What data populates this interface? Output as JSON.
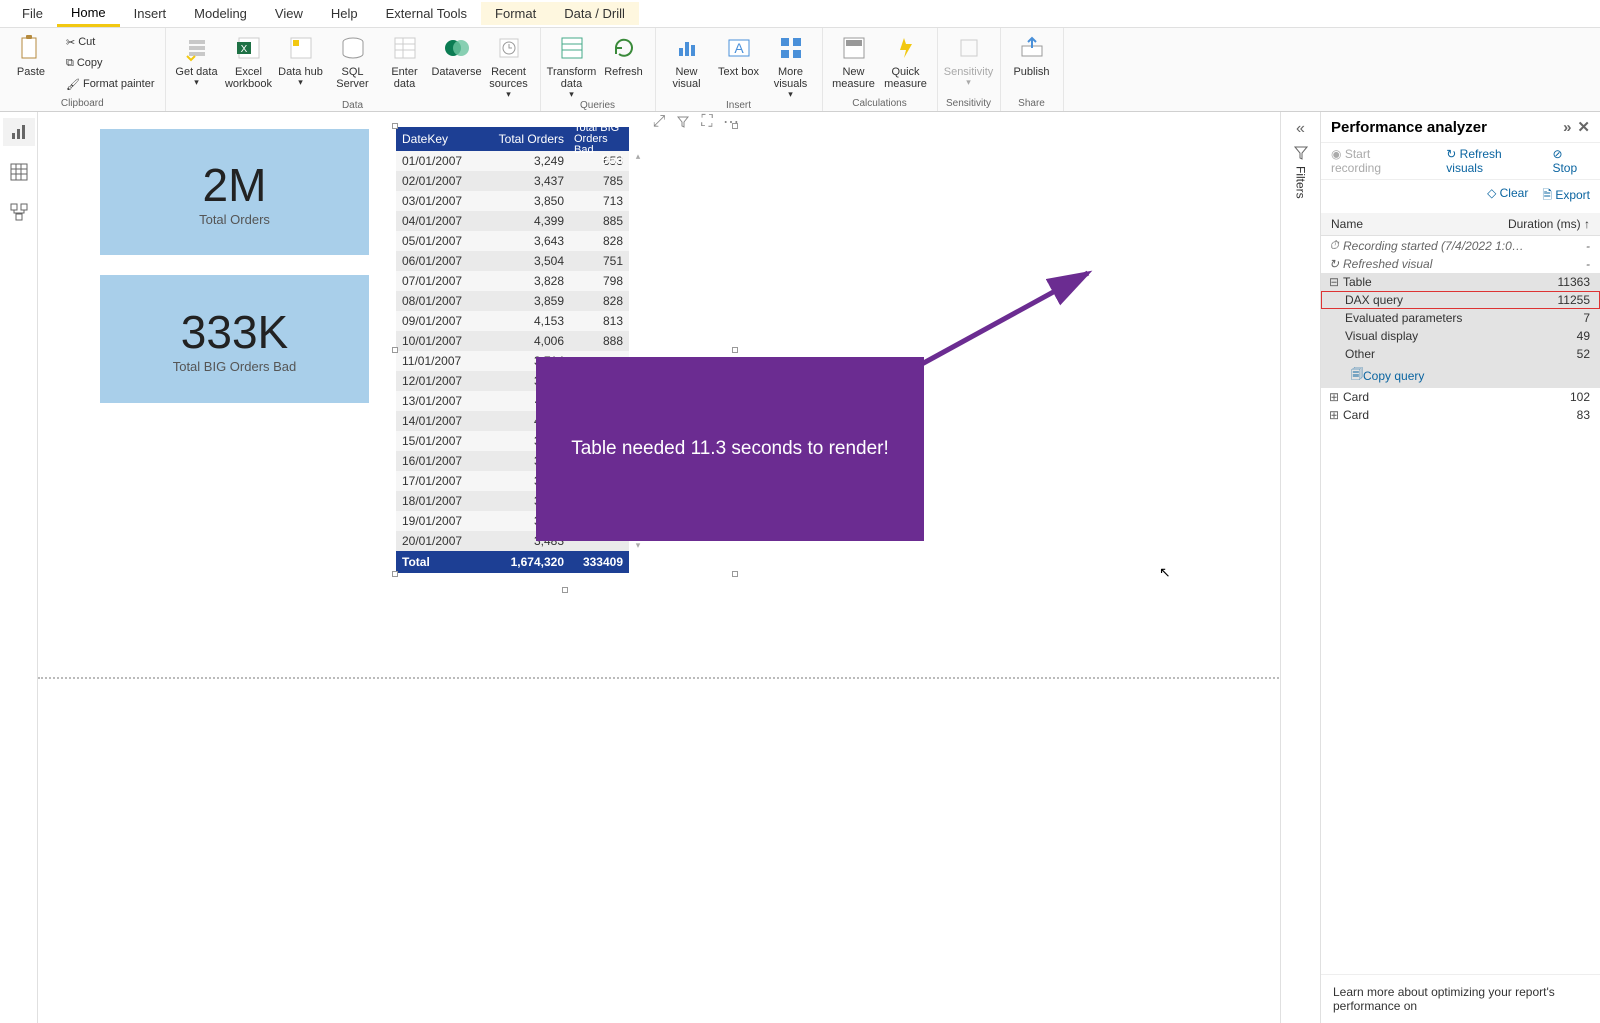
{
  "tabs": {
    "file": "File",
    "home": "Home",
    "insert": "Insert",
    "modeling": "Modeling",
    "view": "View",
    "help": "Help",
    "ext": "External Tools",
    "format": "Format",
    "data": "Data / Drill"
  },
  "ribbon": {
    "clipboard": {
      "paste": "Paste",
      "cut": "Cut",
      "copy": "Copy",
      "fmt": "Format painter",
      "group": "Clipboard"
    },
    "data": {
      "get": "Get data",
      "excel": "Excel workbook",
      "hub": "Data hub",
      "sql": "SQL Server",
      "enter": "Enter data",
      "dv": "Dataverse",
      "recent": "Recent sources",
      "group": "Data"
    },
    "queries": {
      "transform": "Transform data",
      "refresh": "Refresh",
      "group": "Queries"
    },
    "insert": {
      "newvis": "New visual",
      "text": "Text box",
      "more": "More visuals",
      "group": "Insert"
    },
    "calc": {
      "newm": "New measure",
      "quickm": "Quick measure",
      "group": "Calculations"
    },
    "sens": {
      "sens": "Sensitivity",
      "group": "Sensitivity"
    },
    "share": {
      "pub": "Publish",
      "group": "Share"
    }
  },
  "cards": {
    "c1": {
      "value": "2M",
      "label": "Total Orders"
    },
    "c2": {
      "value": "333K",
      "label": "Total BIG Orders Bad"
    }
  },
  "table": {
    "h1": "DateKey",
    "h2": "Total Orders",
    "h3": "Total BIG Orders Bad",
    "rows": [
      {
        "d": "01/01/2007",
        "o": "3,249",
        "b": "653"
      },
      {
        "d": "02/01/2007",
        "o": "3,437",
        "b": "785"
      },
      {
        "d": "03/01/2007",
        "o": "3,850",
        "b": "713"
      },
      {
        "d": "04/01/2007",
        "o": "4,399",
        "b": "885"
      },
      {
        "d": "05/01/2007",
        "o": "3,643",
        "b": "828"
      },
      {
        "d": "06/01/2007",
        "o": "3,504",
        "b": "751"
      },
      {
        "d": "07/01/2007",
        "o": "3,828",
        "b": "798"
      },
      {
        "d": "08/01/2007",
        "o": "3,859",
        "b": "828"
      },
      {
        "d": "09/01/2007",
        "o": "4,153",
        "b": "813"
      },
      {
        "d": "10/01/2007",
        "o": "4,006",
        "b": "888"
      },
      {
        "d": "11/01/2007",
        "o": "3,714",
        "b": ""
      },
      {
        "d": "12/01/2007",
        "o": "3,893",
        "b": ""
      },
      {
        "d": "13/01/2007",
        "o": "4,117",
        "b": ""
      },
      {
        "d": "14/01/2007",
        "o": "4,105",
        "b": ""
      },
      {
        "d": "15/01/2007",
        "o": "3,813",
        "b": ""
      },
      {
        "d": "16/01/2007",
        "o": "3,781",
        "b": ""
      },
      {
        "d": "17/01/2007",
        "o": "3,805",
        "b": ""
      },
      {
        "d": "18/01/2007",
        "o": "3,839",
        "b": ""
      },
      {
        "d": "19/01/2007",
        "o": "3,830",
        "b": ""
      },
      {
        "d": "20/01/2007",
        "o": "3,483",
        "b": ""
      }
    ],
    "totalLabel": "Total",
    "total1": "1,674,320",
    "total2": "333409"
  },
  "filters": {
    "label": "Filters"
  },
  "perf": {
    "title": "Performance analyzer",
    "start": "Start recording",
    "refresh": "Refresh visuals",
    "stop": "Stop",
    "clear": "Clear",
    "export": "Export",
    "colName": "Name",
    "colDur": "Duration (ms)",
    "rows": {
      "rec": "Recording started (7/4/2022 1:0…",
      "refv": "Refreshed visual",
      "table": "Table",
      "tableV": "11363",
      "dax": "DAX query",
      "daxV": "11255",
      "eval": "Evaluated parameters",
      "evalV": "7",
      "vis": "Visual display",
      "visV": "49",
      "other": "Other",
      "otherV": "52",
      "copy": "Copy query",
      "card1": "Card",
      "card1V": "102",
      "card2": "Card",
      "card2V": "83",
      "dash": "-"
    },
    "footer": "Learn more about optimizing your report's performance on"
  },
  "callout": "Table needed 11.3 seconds to render!"
}
